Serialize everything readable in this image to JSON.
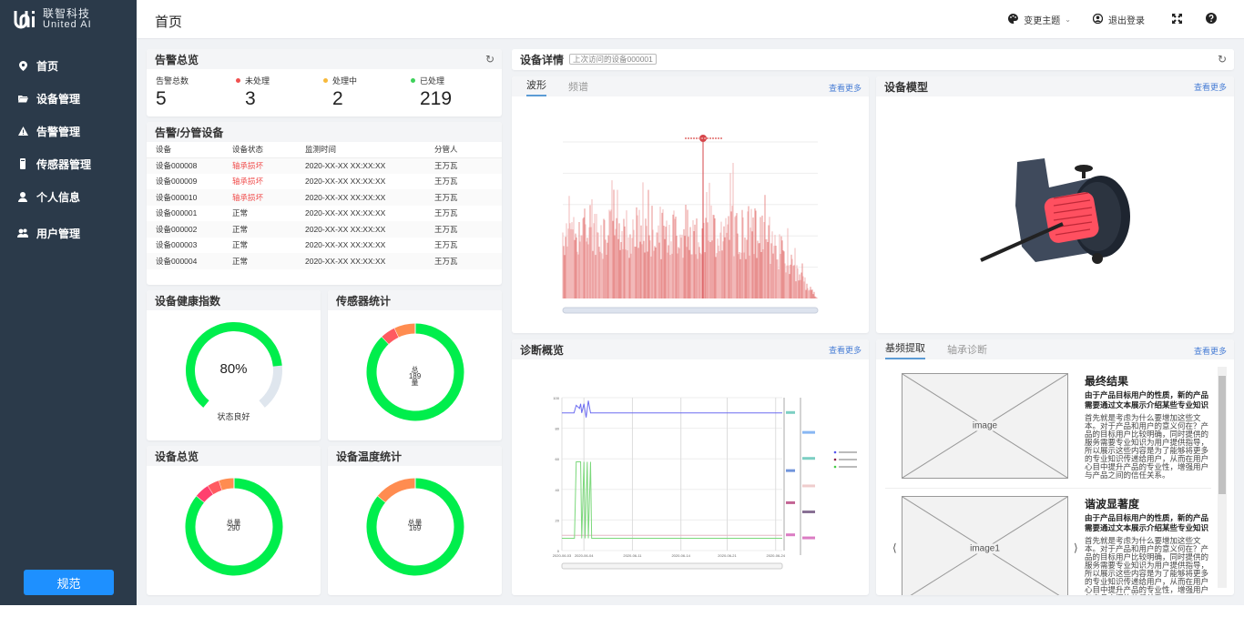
{
  "brand": {
    "cn": "联智科技",
    "en": "United  AI"
  },
  "sidebar": {
    "items": [
      {
        "label": "首页",
        "icon": "map-marker-icon"
      },
      {
        "label": "设备管理",
        "icon": "folder-icon"
      },
      {
        "label": "告警管理",
        "icon": "warning-icon"
      },
      {
        "label": "传感器管理",
        "icon": "sensor-icon"
      },
      {
        "label": "个人信息",
        "icon": "user-icon"
      },
      {
        "label": "用户管理",
        "icon": "users-icon"
      }
    ],
    "spec_button": "规范"
  },
  "header": {
    "title": "首页",
    "theme": "变更主题",
    "logout": "退出登录"
  },
  "alarm_overview": {
    "title": "告警总览",
    "stats": [
      {
        "label": "告警总数",
        "value": "5",
        "color": ""
      },
      {
        "label": "未处理",
        "value": "3",
        "color": "#f0504f"
      },
      {
        "label": "处理中",
        "value": "2",
        "color": "#f7b93b"
      },
      {
        "label": "已处理",
        "value": "219",
        "color": "#3ed15a"
      }
    ]
  },
  "alarm_devices": {
    "title": "告警/分管设备",
    "columns": [
      "设备",
      "设备状态",
      "监测时间",
      "分管人"
    ],
    "rows": [
      {
        "device": "设备000008",
        "status": "轴承损坏",
        "time": "2020-XX-XX XX:XX:XX",
        "owner": "王万瓦"
      },
      {
        "device": "设备000009",
        "status": "轴承损坏",
        "time": "2020-XX-XX XX:XX:XX",
        "owner": "王万瓦"
      },
      {
        "device": "设备000010",
        "status": "轴承损坏",
        "time": "2020-XX-XX XX:XX:XX",
        "owner": "王万瓦"
      },
      {
        "device": "设备000001",
        "status": "正常",
        "time": "2020-XX-XX XX:XX:XX",
        "owner": "王万瓦"
      },
      {
        "device": "设备000002",
        "status": "正常",
        "time": "2020-XX-XX XX:XX:XX",
        "owner": "王万瓦"
      },
      {
        "device": "设备000003",
        "status": "正常",
        "time": "2020-XX-XX XX:XX:XX",
        "owner": "王万瓦"
      },
      {
        "device": "设备000004",
        "status": "正常",
        "time": "2020-XX-XX XX:XX:XX",
        "owner": "王万瓦"
      }
    ]
  },
  "health": {
    "title": "设备健康指数",
    "value": "80%",
    "percent": 80,
    "status": "状态良好"
  },
  "sensor_stats": {
    "title": "传感器统计",
    "total": "189",
    "label_top": "总",
    "label_bottom": "量",
    "segments": [
      {
        "value": 88,
        "color": "#00ee4c"
      },
      {
        "value": 7,
        "color": "#ff8c50"
      },
      {
        "value": 5,
        "color": "#ff5a60"
      }
    ]
  },
  "device_overview": {
    "title": "设备总览",
    "total": "290",
    "label": "总量",
    "segments": [
      {
        "value": 86,
        "color": "#00ee4c"
      },
      {
        "value": 5,
        "color": "#ff8c50"
      },
      {
        "value": 4,
        "color": "#ff5a60"
      },
      {
        "value": 5,
        "color": "#ff3f6e"
      }
    ]
  },
  "temp_stats": {
    "title": "设备温度统计",
    "total": "169",
    "label": "总量",
    "segments": [
      {
        "value": 86,
        "color": "#00ee4c"
      },
      {
        "value": 14,
        "color": "#ff8c50"
      }
    ]
  },
  "device_detail": {
    "title": "设备详情",
    "dropdown": "上次访问的设备000001",
    "tabs": [
      "波形",
      "频谱"
    ],
    "more": "查看更多"
  },
  "device_model": {
    "title": "设备模型",
    "more": "查看更多"
  },
  "diagnosis": {
    "title": "诊断概览",
    "more": "查看更多",
    "x_ticks": [
      "2020-06-03",
      "2020-06-04",
      "2020-06-11",
      "2020-06-14",
      "2020-06-21",
      "2020-06-24"
    ],
    "y_ticks": [
      "0",
      "20",
      "40",
      "60",
      "80",
      "100"
    ]
  },
  "feature": {
    "tabs": [
      "基频提取",
      "轴承诊断"
    ],
    "more": "查看更多",
    "items": [
      {
        "image": "image",
        "title": "最终结果",
        "subtitle": "由于产品目标用户的性质，新的产品需要通过文本展示介绍某些专业知识",
        "body": "首先就是考虑为什么要增加这些文本。对于产品和用户的意义何在？产品的目标用户比较明确，同时提供的服务需要专业知识为用户提供指导，所以展示这些内容是为了能够将更多的专业知识传递给用户，从而在用户心目中提升产品的专业性，增强用户与产品之间的信任关系。"
      },
      {
        "image": "image1",
        "title": "谐波显著度",
        "subtitle": "由于产品目标用户的性质，新的产品需要通过文本展示介绍某些专业知识",
        "body": "首先就是考虑为什么要增加这些文本。对于产品和用户的意义何在？产品的目标用户比较明确，同时提供的服务需要专业知识为用户提供指导，所以展示这些内容是为了能够将更多的专业知识传递给用户，从而在用户心目中提升产品的专业性，增强用户与产品之间的信任关系。"
      }
    ]
  }
}
